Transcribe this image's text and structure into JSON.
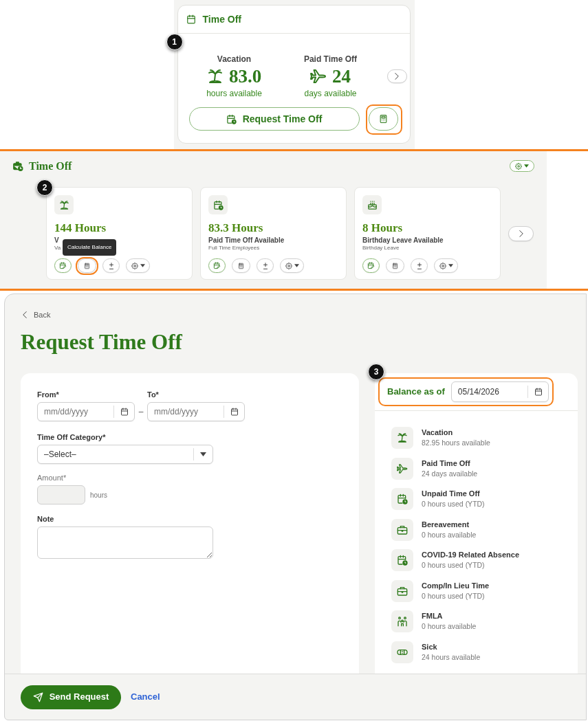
{
  "overview_card": {
    "title": "Time Off",
    "callout": "1",
    "stats": [
      {
        "kind": "vacation",
        "label": "Vacation",
        "value": "83.0",
        "unit": "hours available"
      },
      {
        "kind": "travel",
        "label": "Paid Time Off",
        "value": "24",
        "unit": "days available"
      }
    ],
    "request_button": "Request Time Off",
    "calculator_button": {
      "highlighted": true
    }
  },
  "balances_widget": {
    "title": "Time Off",
    "callout": "2",
    "cards": [
      {
        "kind": "vacation",
        "amount": "144 Hours",
        "title": "V",
        "subtitle": "Va",
        "actions": [
          {
            "kind": "request",
            "highlighted": false
          },
          {
            "kind": "calculate",
            "highlighted": true,
            "tooltip": "Calculate Balance"
          },
          {
            "kind": "adjust",
            "highlighted": false
          },
          {
            "kind": "settings",
            "highlighted": false
          }
        ]
      },
      {
        "kind": "leave",
        "amount": "83.3 Hours",
        "title": "Paid Time Off Available",
        "subtitle": "Full Time Employees",
        "actions": [
          {
            "kind": "request",
            "highlighted": false
          },
          {
            "kind": "calculate",
            "highlighted": false
          },
          {
            "kind": "adjust",
            "highlighted": false
          },
          {
            "kind": "settings",
            "highlighted": false
          }
        ]
      },
      {
        "kind": "birthday",
        "amount": "8 Hours",
        "title": "Birthday Leave Available",
        "subtitle": "Birthday Leave",
        "actions": [
          {
            "kind": "request",
            "highlighted": false
          },
          {
            "kind": "calculate",
            "highlighted": false
          },
          {
            "kind": "adjust",
            "highlighted": false
          },
          {
            "kind": "settings",
            "highlighted": false
          }
        ]
      }
    ]
  },
  "request_form": {
    "back_link": "Back",
    "title": "Request Time Off",
    "from": {
      "label": "From*",
      "placeholder": "mm/dd/yyyy"
    },
    "range_separator": "–",
    "to": {
      "label": "To*",
      "placeholder": "mm/dd/yyyy"
    },
    "category": {
      "label": "Time Off Category*",
      "value": "–Select–"
    },
    "amount": {
      "label": "Amount*",
      "unit": "hours",
      "disabled": true
    },
    "note": {
      "label": "Note"
    },
    "balance_panel": {
      "callout": "3",
      "label": "Balance as of",
      "date": "05/14/2026",
      "highlighted": true,
      "items": [
        {
          "kind": "vacation",
          "name": "Vacation",
          "detail": "82.95 hours available"
        },
        {
          "kind": "travel",
          "name": "Paid Time Off",
          "detail": "24 days available"
        },
        {
          "kind": "leave",
          "name": "Unpaid Time Off",
          "detail": "0 hours used (YTD)"
        },
        {
          "kind": "work",
          "name": "Bereavement",
          "detail": "0 hours available"
        },
        {
          "kind": "leave",
          "name": "COVID-19 Related Absence",
          "detail": "0 hours used (YTD)"
        },
        {
          "kind": "work",
          "name": "Comp/In Lieu Time",
          "detail": "0 hours used (YTD)"
        },
        {
          "kind": "family",
          "name": "FMLA",
          "detail": "0 hours available"
        },
        {
          "kind": "medical",
          "name": "Sick",
          "detail": "24 hours available"
        }
      ]
    },
    "send_button": "Send Request",
    "cancel_link": "Cancel"
  }
}
